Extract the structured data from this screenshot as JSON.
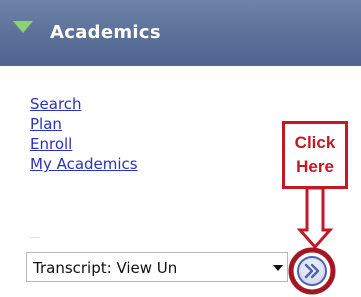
{
  "header": {
    "title": "Academics",
    "icon": "triangle-down-icon",
    "colors": {
      "background": "#5a7098",
      "triangle": "#8bd36b",
      "text": "#ffffff"
    }
  },
  "links": [
    {
      "label": "Search"
    },
    {
      "label": "Plan"
    },
    {
      "label": "Enroll"
    },
    {
      "label": "My Academics"
    }
  ],
  "selector": {
    "selected_value": "Transcript: View Un",
    "icon": "chevron-down-icon"
  },
  "go_button": {
    "icon": "double-chevron-right-icon",
    "color": "#4d63b0"
  },
  "annotation": {
    "text": "Click Here",
    "color": "#c01a27"
  }
}
